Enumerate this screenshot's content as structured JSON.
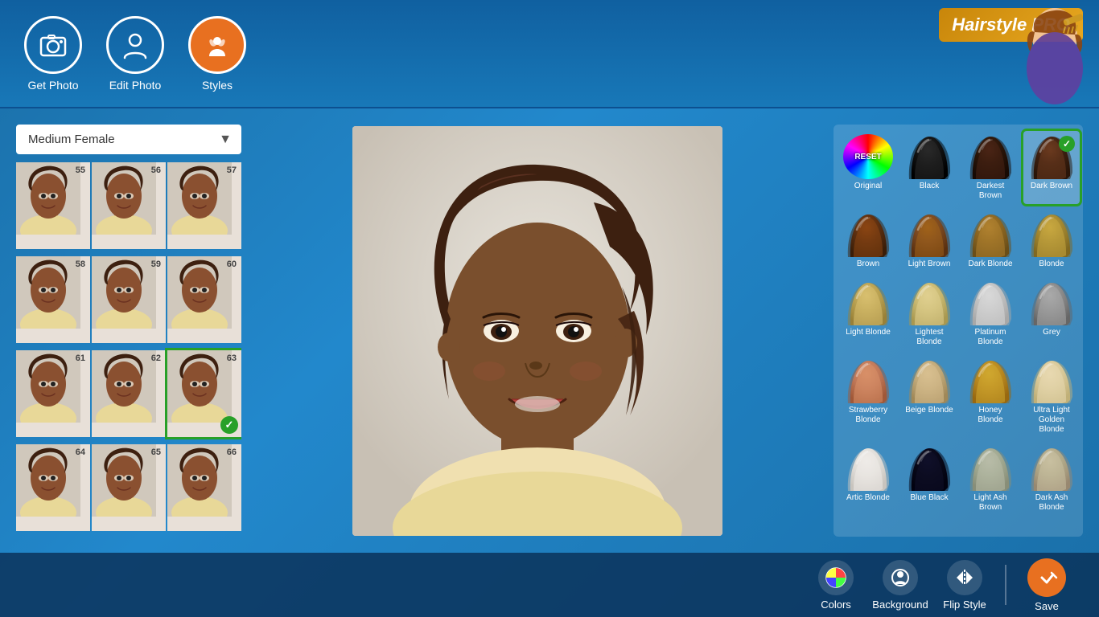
{
  "app": {
    "title": "Hairstyle PRO"
  },
  "header": {
    "nav": [
      {
        "id": "get-photo",
        "label": "Get Photo",
        "icon": "📷",
        "active": false
      },
      {
        "id": "edit-photo",
        "label": "Edit Photo",
        "icon": "👤",
        "active": false
      },
      {
        "id": "styles",
        "label": "Styles",
        "icon": "🪮",
        "active": true
      }
    ]
  },
  "style_panel": {
    "dropdown_label": "Medium Female",
    "styles": [
      {
        "num": 55,
        "selected": false
      },
      {
        "num": 56,
        "selected": false
      },
      {
        "num": 57,
        "selected": false
      },
      {
        "num": 58,
        "selected": false
      },
      {
        "num": 59,
        "selected": false
      },
      {
        "num": 60,
        "selected": false
      },
      {
        "num": 61,
        "selected": false
      },
      {
        "num": 62,
        "selected": false
      },
      {
        "num": 63,
        "selected": true
      },
      {
        "num": 64,
        "selected": false
      },
      {
        "num": 65,
        "selected": false
      },
      {
        "num": 66,
        "selected": false
      }
    ]
  },
  "colors": [
    {
      "id": "reset",
      "label": "Original",
      "type": "reset"
    },
    {
      "id": "black",
      "label": "Black",
      "type": "black",
      "selected": false
    },
    {
      "id": "darkest-brown",
      "label": "Darkest Brown",
      "type": "darkest-brown",
      "selected": false
    },
    {
      "id": "dark-brown",
      "label": "Dark Brown",
      "type": "dark-brown",
      "selected": true
    },
    {
      "id": "brown",
      "label": "Brown",
      "type": "brown",
      "selected": false
    },
    {
      "id": "light-brown",
      "label": "Light Brown",
      "type": "light-brown",
      "selected": false
    },
    {
      "id": "dark-blonde",
      "label": "Dark Blonde",
      "type": "dark-blonde",
      "selected": false
    },
    {
      "id": "blonde",
      "label": "Blonde",
      "type": "blonde",
      "selected": false
    },
    {
      "id": "light-blonde",
      "label": "Light Blonde",
      "type": "light-blonde",
      "selected": false
    },
    {
      "id": "lightest-blonde",
      "label": "Lightest Blonde",
      "type": "lightest-blonde",
      "selected": false
    },
    {
      "id": "platinum",
      "label": "Platinum Blonde",
      "type": "platinum",
      "selected": false
    },
    {
      "id": "grey",
      "label": "Grey",
      "type": "grey",
      "selected": false
    },
    {
      "id": "strawberry",
      "label": "Strawberry Blonde",
      "type": "strawberry",
      "selected": false
    },
    {
      "id": "beige-blonde",
      "label": "Beige Blonde",
      "type": "beige-blonde",
      "selected": false
    },
    {
      "id": "honey-blonde",
      "label": "Honey Blonde",
      "type": "honey-blonde",
      "selected": false
    },
    {
      "id": "ultra-light",
      "label": "Ultra Light Golden Blonde",
      "type": "ultra-light",
      "selected": false
    },
    {
      "id": "artic-blonde",
      "label": "Artic Blonde",
      "type": "artic-blonde",
      "selected": false
    },
    {
      "id": "blue-black",
      "label": "Blue Black",
      "type": "blue-black",
      "selected": false
    },
    {
      "id": "light-ash",
      "label": "Light Ash Brown",
      "type": "light-ash",
      "selected": false
    },
    {
      "id": "dark-ash",
      "label": "Dark Ash Blonde",
      "type": "dark-ash",
      "selected": false
    }
  ],
  "toolbar": {
    "colors_label": "Colors",
    "background_label": "Background",
    "flip_label": "Flip Style",
    "save_label": "Save"
  }
}
